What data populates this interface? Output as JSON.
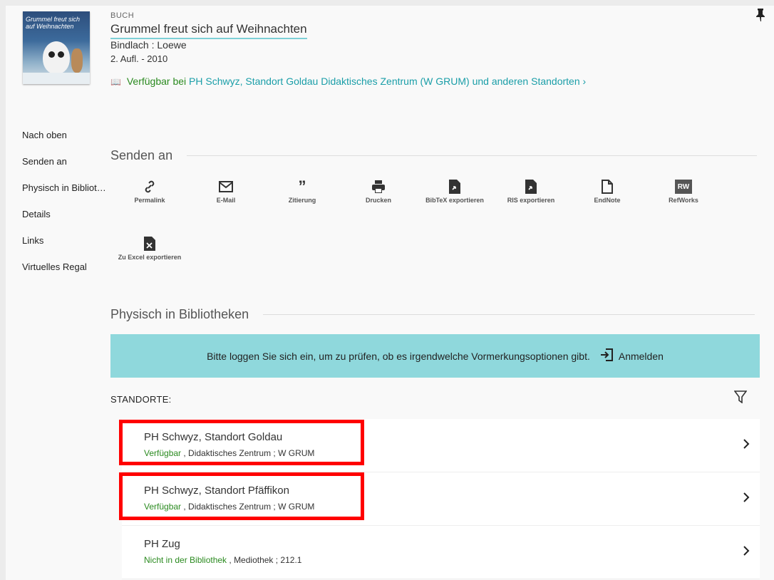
{
  "record": {
    "type": "BUCH",
    "title": "Grummel freut sich auf Weihnachten",
    "publisher": "Bindlach : Loewe",
    "edition": "2. Aufl. - 2010",
    "cover_text": "Grummel freut sich auf Weihnachten",
    "availability_prefix": "Verfügbar bei",
    "availability_location": "PH Schwyz, Standort Goldau  Didaktisches Zentrum (W GRUM) und anderen Standorten",
    "availability_chevron": "›"
  },
  "sidenav": {
    "items": [
      {
        "label": "Nach oben"
      },
      {
        "label": "Senden an"
      },
      {
        "label": "Physisch in Bibliotheken"
      },
      {
        "label": "Details"
      },
      {
        "label": "Links"
      },
      {
        "label": "Virtuelles Regal"
      }
    ]
  },
  "send_section": {
    "heading": "Senden an",
    "actions": [
      {
        "label": "Permalink",
        "icon": "link-icon"
      },
      {
        "label": "E-Mail",
        "icon": "mail-icon"
      },
      {
        "label": "Zitierung",
        "icon": "quote-icon"
      },
      {
        "label": "Drucken",
        "icon": "printer-icon"
      },
      {
        "label": "BibTeX exportieren",
        "icon": "export-file-icon"
      },
      {
        "label": "RIS exportieren",
        "icon": "export-file-icon"
      },
      {
        "label": "EndNote",
        "icon": "file-icon"
      },
      {
        "label": "RefWorks",
        "icon": "refworks-icon",
        "badge": "RW"
      },
      {
        "label": "Zu Excel exportieren",
        "icon": "excel-icon"
      }
    ]
  },
  "holdings": {
    "heading": "Physisch in Bibliotheken",
    "login_message": "Bitte loggen Sie sich ein, um zu prüfen, ob es irgendwelche Vormerkungsoptionen gibt.",
    "login_button": "Anmelden",
    "locations_label": "STANDORTE:",
    "locations": [
      {
        "name": "PH Schwyz, Standort Goldau",
        "status": "Verfügbar",
        "details": " , Didaktisches Zentrum ; W GRUM"
      },
      {
        "name": "PH Schwyz, Standort Pfäffikon",
        "status": "Verfügbar",
        "details": " , Didaktisches Zentrum ; W GRUM"
      },
      {
        "name": "PH Zug",
        "status": "Nicht in der Bibliothek",
        "details": " , Mediothek ; 212.1"
      }
    ]
  },
  "colors": {
    "accent_teal": "#8fd8dc",
    "available_green": "#2a8a1f",
    "link_teal": "#1a9ea8",
    "highlight_red": "#ff0000"
  }
}
